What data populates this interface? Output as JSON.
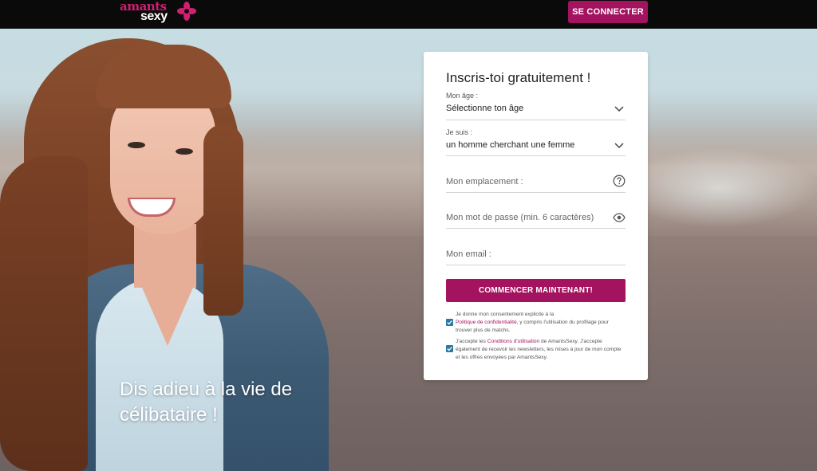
{
  "header": {
    "logo_line1": "amants",
    "logo_line2": "sexy",
    "login_button": "SE CONNECTER"
  },
  "hero": {
    "tagline_line1": "Dis adieu à la vie de",
    "tagline_line2": "célibataire !"
  },
  "signup": {
    "title": "Inscris-toi gratuitement !",
    "age": {
      "label": "Mon âge :",
      "value": "Sélectionne ton âge",
      "icon": "chevron-down-icon"
    },
    "iam": {
      "label": "Je suis :",
      "value": "un homme cherchant une femme",
      "icon": "chevron-down-icon"
    },
    "location": {
      "placeholder": "Mon emplacement :",
      "icon": "help-circle-icon"
    },
    "password": {
      "placeholder": "Mon mot de passe (min. 6 caractères)",
      "icon": "eye-icon"
    },
    "email": {
      "placeholder": "Mon email :"
    },
    "submit_button": "COMMENCER MAINTENANT!",
    "consent1": {
      "checked": true,
      "before": "Je donne mon consentement explicite à la",
      "link": "Politique de confidentialité",
      "after": ", y compris l'utilisation du profilage pour trouver plus de matchs."
    },
    "consent2": {
      "checked": true,
      "before": "J'accepte les",
      "link": "Conditions d'utilisation",
      "after": "de AmantsSexy. J'accepte également de recevoir les newsletters, les mises à jour de mon compte et les offres envoyées par AmantsSexy."
    }
  },
  "colors": {
    "brand": "#a3135f",
    "logo_pink": "#d21f72",
    "checkbox": "#2b7aa1"
  }
}
